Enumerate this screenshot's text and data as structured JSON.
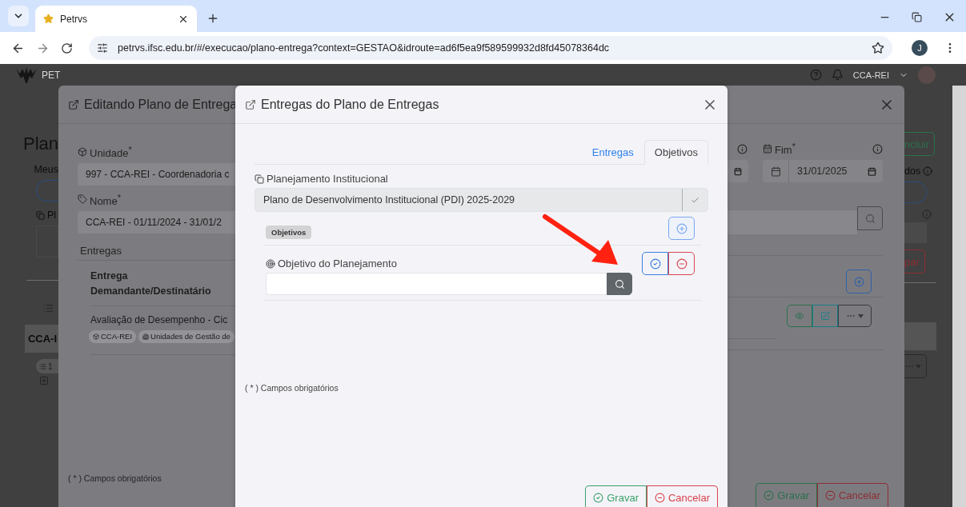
{
  "browser": {
    "tab_title": "Petrvs",
    "url": "petrvs.ifsc.edu.br/#/execucao/plano-entrega?context=GESTAO&idroute=ad6f5ea9f589599932d8fd45078364dc",
    "profile_initial": "J"
  },
  "navbar": {
    "brand": "PET",
    "user": "CCA-REI"
  },
  "background_left": {
    "title": "Plan",
    "tab_label": "Meus",
    "item": "Pl",
    "group": "CCA-I",
    "count": "1"
  },
  "background_right": {
    "add_button": "ncluir",
    "filter_label": "dos",
    "clear_button": "par"
  },
  "edit_modal": {
    "title": "Editando Plano de Entrega",
    "unidade_label": "Unidade$^{*}$",
    "unidade_value": "997 - CCA-REI - Coordenadoria c",
    "nome_label": "Nome$^{*}$",
    "nome_value": "CCA-REI - 01/11/2024 - 31/01/2",
    "entregas_label": "Entregas",
    "columns": [
      "Entrega",
      "Demandante/Destinatário"
    ],
    "row": {
      "title": "Avaliação de Desempenho - Cic",
      "tags": [
        "CCA-REI",
        "Unidades de Gestão de"
      ]
    },
    "fim_label": "Fim$^{*}$",
    "fim_value": "31/01/2025",
    "required_note": "( * ) Campos obrigatórios",
    "buttons": [
      {
        "label": "Gravar",
        "kind": "save"
      },
      {
        "label": "Cancelar",
        "kind": "cancel"
      }
    ]
  },
  "entregas_modal": {
    "title": "Entregas do Plano de Entregas",
    "tabs": [
      {
        "label": "Entregas",
        "selected": false
      },
      {
        "label": "Objetivos",
        "selected": true
      }
    ],
    "planejamento_label": "Planejamento Institucional",
    "planejamento_value": "Plano de Desenvolvimento Institucional (PDI) 2025-2029",
    "objetivos_badge": "Objetivos",
    "objetivo_label": "Objetivo do Planejamento",
    "required_note": "( * ) Campos obrigatórios",
    "buttons": [
      {
        "label": "Gravar",
        "kind": "save"
      },
      {
        "label": "Cancelar",
        "kind": "cancel"
      }
    ]
  }
}
